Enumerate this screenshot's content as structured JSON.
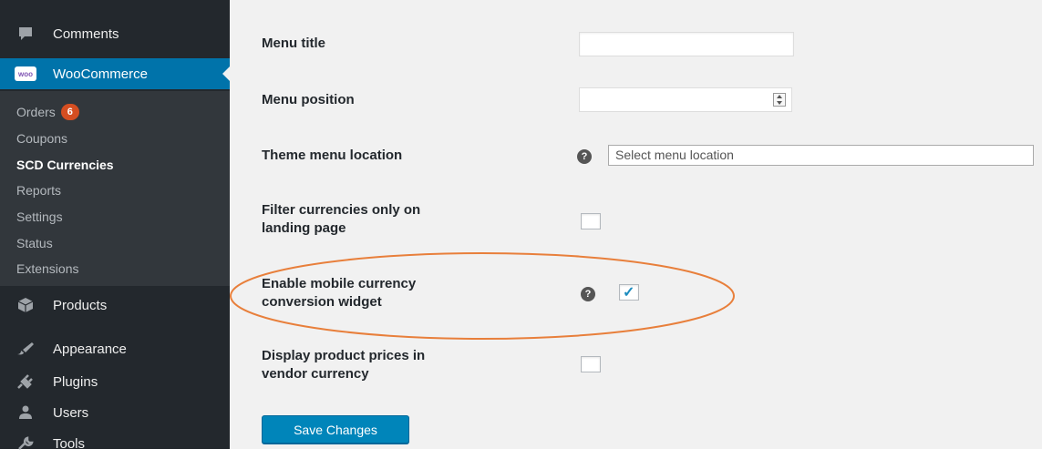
{
  "sidebar": {
    "comments": {
      "label": "Comments",
      "icon": "comment-icon"
    },
    "woocommerce": {
      "label": "WooCommerce",
      "icon": "woocommerce-logo",
      "logo_text": "woo"
    },
    "submenu": [
      {
        "label": "Orders",
        "badge": "6"
      },
      {
        "label": "Coupons"
      },
      {
        "label": "SCD Currencies"
      },
      {
        "label": "Reports"
      },
      {
        "label": "Settings"
      },
      {
        "label": "Status"
      },
      {
        "label": "Extensions"
      }
    ],
    "products": {
      "label": "Products",
      "icon": "box-icon"
    },
    "appearance": {
      "label": "Appearance",
      "icon": "brush-icon"
    },
    "plugins": {
      "label": "Plugins",
      "icon": "plug-icon"
    },
    "users": {
      "label": "Users",
      "icon": "user-icon"
    },
    "tools": {
      "label": "Tools",
      "icon": "wrench-icon"
    }
  },
  "form": {
    "menu_title": {
      "label": "Menu title",
      "value": ""
    },
    "menu_position": {
      "label": "Menu position",
      "value": ""
    },
    "theme_menu_location": {
      "label": "Theme menu location",
      "placeholder": "Select menu location"
    },
    "filter_landing": {
      "label_line1": "Filter currencies only on",
      "label_line2": "landing page",
      "checked": false
    },
    "mobile_widget": {
      "label_line1": "Enable mobile currency",
      "label_line2": "conversion widget",
      "checked": true
    },
    "vendor_currency": {
      "label_line1": "Display product prices in",
      "label_line2": "vendor currency",
      "checked": false
    },
    "save_label": "Save Changes"
  },
  "colors": {
    "sidebar_bg": "#23282d",
    "submenu_bg": "#32373c",
    "accent": "#0073aa",
    "button": "#0085ba",
    "highlight": "#e87f3b",
    "badge": "#d54e21"
  }
}
